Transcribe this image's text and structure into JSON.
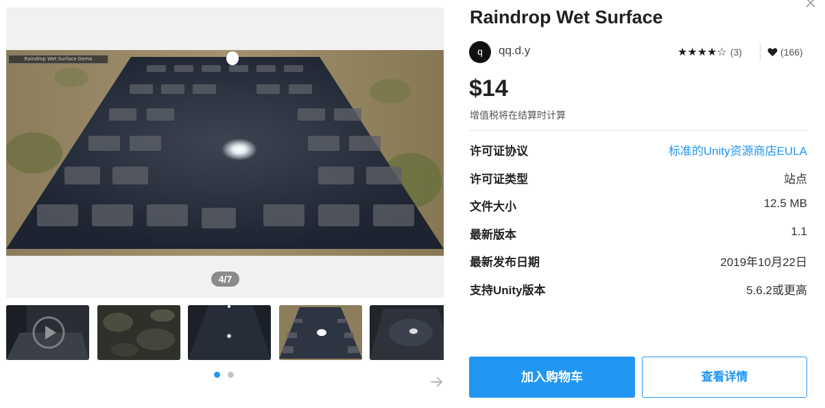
{
  "gallery": {
    "demo_label": "Raindrop Wet Surface Demo",
    "counter": "4/7",
    "thumbnails": [
      {
        "name": "thumb-1"
      },
      {
        "name": "thumb-2"
      },
      {
        "name": "thumb-3"
      },
      {
        "name": "thumb-4"
      },
      {
        "name": "thumb-5"
      }
    ],
    "pagination": {
      "active": 1,
      "total": 2
    },
    "next_icon": "arrow-right-icon"
  },
  "product": {
    "title": "Raindrop Wet Surface",
    "publisher_initial": "q",
    "publisher": "qq.d.y",
    "stars": "★★★★☆",
    "rating_value": 4,
    "rating_count": "(3)",
    "favorites": "(166)",
    "price": "$14",
    "vat_note": "增值税将在结算时计算"
  },
  "specs": [
    {
      "label": "许可证协议",
      "value": "标准的Unity资源商店EULA",
      "is_link": true
    },
    {
      "label": "许可证类型",
      "value": "站点"
    },
    {
      "label": "文件大小",
      "value": "12.5 MB"
    },
    {
      "label": "最新版本",
      "value": "1.1"
    },
    {
      "label": "最新发布日期",
      "value": "2019年10月22日"
    },
    {
      "label": "支持Unity版本",
      "value": "5.6.2或更高"
    }
  ],
  "actions": {
    "add_to_cart": "加入购物车",
    "view_details": "查看详情"
  },
  "colors": {
    "accent": "#2196f3",
    "text": "#212121",
    "counter_bg": "#8b8b8b"
  }
}
